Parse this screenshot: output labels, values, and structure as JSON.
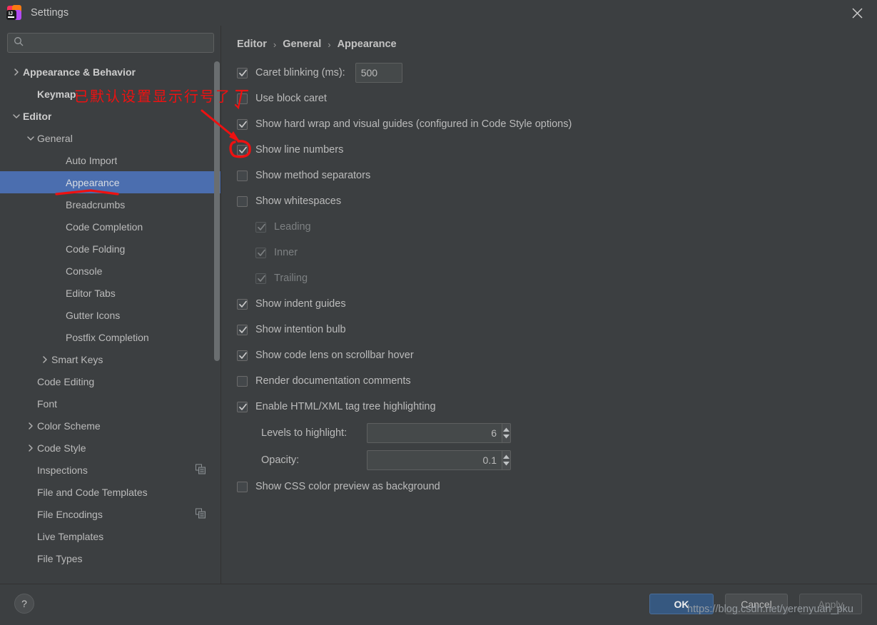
{
  "window": {
    "title": "Settings",
    "logo_icon": "intellij-idea-logo",
    "close_icon": "close-icon"
  },
  "sidebar": {
    "search": {
      "value": "",
      "placeholder": "",
      "icon": "search-icon"
    },
    "items": [
      {
        "label": "Appearance & Behavior",
        "indent": 0,
        "arrow": "chevron-right-icon",
        "bold": true,
        "selected": false,
        "copy_icon": false
      },
      {
        "label": "Keymap",
        "indent": 1,
        "arrow": "",
        "bold": true,
        "selected": false,
        "copy_icon": false
      },
      {
        "label": "Editor",
        "indent": 0,
        "arrow": "chevron-down-icon",
        "bold": true,
        "selected": false,
        "copy_icon": false
      },
      {
        "label": "General",
        "indent": 1,
        "arrow": "chevron-down-icon",
        "bold": false,
        "selected": false,
        "copy_icon": false
      },
      {
        "label": "Auto Import",
        "indent": 3,
        "arrow": "",
        "bold": false,
        "selected": false,
        "copy_icon": false
      },
      {
        "label": "Appearance",
        "indent": 3,
        "arrow": "",
        "bold": false,
        "selected": true,
        "copy_icon": false
      },
      {
        "label": "Breadcrumbs",
        "indent": 3,
        "arrow": "",
        "bold": false,
        "selected": false,
        "copy_icon": false
      },
      {
        "label": "Code Completion",
        "indent": 3,
        "arrow": "",
        "bold": false,
        "selected": false,
        "copy_icon": false
      },
      {
        "label": "Code Folding",
        "indent": 3,
        "arrow": "",
        "bold": false,
        "selected": false,
        "copy_icon": false
      },
      {
        "label": "Console",
        "indent": 3,
        "arrow": "",
        "bold": false,
        "selected": false,
        "copy_icon": false
      },
      {
        "label": "Editor Tabs",
        "indent": 3,
        "arrow": "",
        "bold": false,
        "selected": false,
        "copy_icon": false
      },
      {
        "label": "Gutter Icons",
        "indent": 3,
        "arrow": "",
        "bold": false,
        "selected": false,
        "copy_icon": false
      },
      {
        "label": "Postfix Completion",
        "indent": 3,
        "arrow": "",
        "bold": false,
        "selected": false,
        "copy_icon": false
      },
      {
        "label": "Smart Keys",
        "indent": 2,
        "arrow": "chevron-right-icon",
        "bold": false,
        "selected": false,
        "copy_icon": false
      },
      {
        "label": "Code Editing",
        "indent": 1,
        "arrow": "",
        "bold": false,
        "selected": false,
        "copy_icon": false
      },
      {
        "label": "Font",
        "indent": 1,
        "arrow": "",
        "bold": false,
        "selected": false,
        "copy_icon": false
      },
      {
        "label": "Color Scheme",
        "indent": 1,
        "arrow": "chevron-right-icon",
        "bold": false,
        "selected": false,
        "copy_icon": false
      },
      {
        "label": "Code Style",
        "indent": 1,
        "arrow": "chevron-right-icon",
        "bold": false,
        "selected": false,
        "copy_icon": false
      },
      {
        "label": "Inspections",
        "indent": 1,
        "arrow": "",
        "bold": false,
        "selected": false,
        "copy_icon": true
      },
      {
        "label": "File and Code Templates",
        "indent": 1,
        "arrow": "",
        "bold": false,
        "selected": false,
        "copy_icon": false
      },
      {
        "label": "File Encodings",
        "indent": 1,
        "arrow": "",
        "bold": false,
        "selected": false,
        "copy_icon": true
      },
      {
        "label": "Live Templates",
        "indent": 1,
        "arrow": "",
        "bold": false,
        "selected": false,
        "copy_icon": false
      },
      {
        "label": "File Types",
        "indent": 1,
        "arrow": "",
        "bold": false,
        "selected": false,
        "copy_icon": false
      }
    ]
  },
  "content": {
    "breadcrumb": [
      "Editor",
      "General",
      "Appearance"
    ],
    "breadcrumb_separator": "›",
    "options": [
      {
        "type": "checkbox-field",
        "label": "Caret blinking (ms):",
        "checked": true,
        "enabled": true,
        "indent": 0,
        "field_value": "500"
      },
      {
        "type": "checkbox",
        "label": "Use block caret",
        "checked": false,
        "enabled": true,
        "indent": 0
      },
      {
        "type": "checkbox",
        "label": "Show hard wrap and visual guides (configured in Code Style options)",
        "checked": true,
        "enabled": true,
        "indent": 0
      },
      {
        "type": "checkbox",
        "label": "Show line numbers",
        "checked": true,
        "enabled": true,
        "indent": 0
      },
      {
        "type": "checkbox",
        "label": "Show method separators",
        "checked": false,
        "enabled": true,
        "indent": 0
      },
      {
        "type": "checkbox",
        "label": "Show whitespaces",
        "checked": false,
        "enabled": true,
        "indent": 0
      },
      {
        "type": "checkbox",
        "label": "Leading",
        "checked": true,
        "enabled": false,
        "indent": 1
      },
      {
        "type": "checkbox",
        "label": "Inner",
        "checked": true,
        "enabled": false,
        "indent": 1
      },
      {
        "type": "checkbox",
        "label": "Trailing",
        "checked": true,
        "enabled": false,
        "indent": 1
      },
      {
        "type": "checkbox",
        "label": "Show indent guides",
        "checked": true,
        "enabled": true,
        "indent": 0
      },
      {
        "type": "checkbox",
        "label": "Show intention bulb",
        "checked": true,
        "enabled": true,
        "indent": 0
      },
      {
        "type": "checkbox",
        "label": "Show code lens on scrollbar hover",
        "checked": true,
        "enabled": true,
        "indent": 0
      },
      {
        "type": "checkbox",
        "label": "Render documentation comments",
        "checked": false,
        "enabled": true,
        "indent": 0
      },
      {
        "type": "checkbox",
        "label": "Enable HTML/XML tag tree highlighting",
        "checked": true,
        "enabled": true,
        "indent": 0
      },
      {
        "type": "spinner",
        "label": "Levels to highlight:",
        "value": "6"
      },
      {
        "type": "spinner",
        "label": "Opacity:",
        "value": "0.1"
      },
      {
        "type": "checkbox",
        "label": "Show CSS color preview as background",
        "checked": false,
        "enabled": true,
        "indent": 0
      }
    ]
  },
  "footer": {
    "help_label": "?",
    "ok_label": "OK",
    "cancel_label": "Cancel",
    "apply_label": "Apply"
  },
  "annotations": {
    "note_text": "已默认设置显示行号了",
    "watermark": "https://blog.csdn.net/yerenyuan_pku",
    "highlight_color": "#ee1111"
  }
}
